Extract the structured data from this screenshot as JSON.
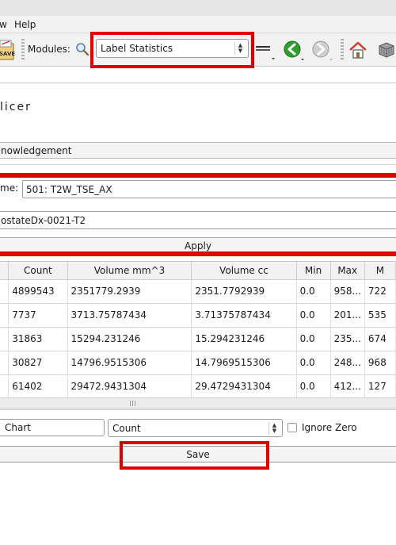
{
  "menu": {
    "view": "w",
    "help": "Help"
  },
  "toolbar": {
    "save_icon_text": "SAVE",
    "modules_label": "Modules:",
    "module_selected": "Label Statistics"
  },
  "header": {
    "title": "licer"
  },
  "acknowledgement_label": "nowledgement",
  "volume": {
    "label": "me:",
    "value": "501: T2W_TSE_AX"
  },
  "labelmap_value": "ostateDx-0021-T2",
  "apply_label": "Apply",
  "table": {
    "columns": [
      "Count",
      "Volume mm^3",
      "Volume cc",
      "Min",
      "Max",
      "M"
    ],
    "rows": [
      [
        "4899543",
        "2351779.2939",
        "2351.7792939",
        "0.0",
        "958...",
        "722"
      ],
      [
        "7737",
        "3713.75787434",
        "3.71375787434",
        "0.0",
        "201...",
        "535"
      ],
      [
        "31863",
        "15294.231246",
        "15.294231246",
        "0.0",
        "235...",
        "674"
      ],
      [
        "30827",
        "14796.9515306",
        "14.7969515306",
        "0.0",
        "248...",
        "968"
      ],
      [
        "61402",
        "29472.9431304",
        "29.4729431304",
        "0.0",
        "412...",
        "127"
      ]
    ]
  },
  "chart_button": "Chart",
  "chart_option": "Count",
  "ignore_zero": "Ignore Zero",
  "save_label": "Save",
  "colors": {
    "highlight": "#e00000",
    "home_roof": "#d33a2c",
    "nav_green": "#2fa02f"
  }
}
